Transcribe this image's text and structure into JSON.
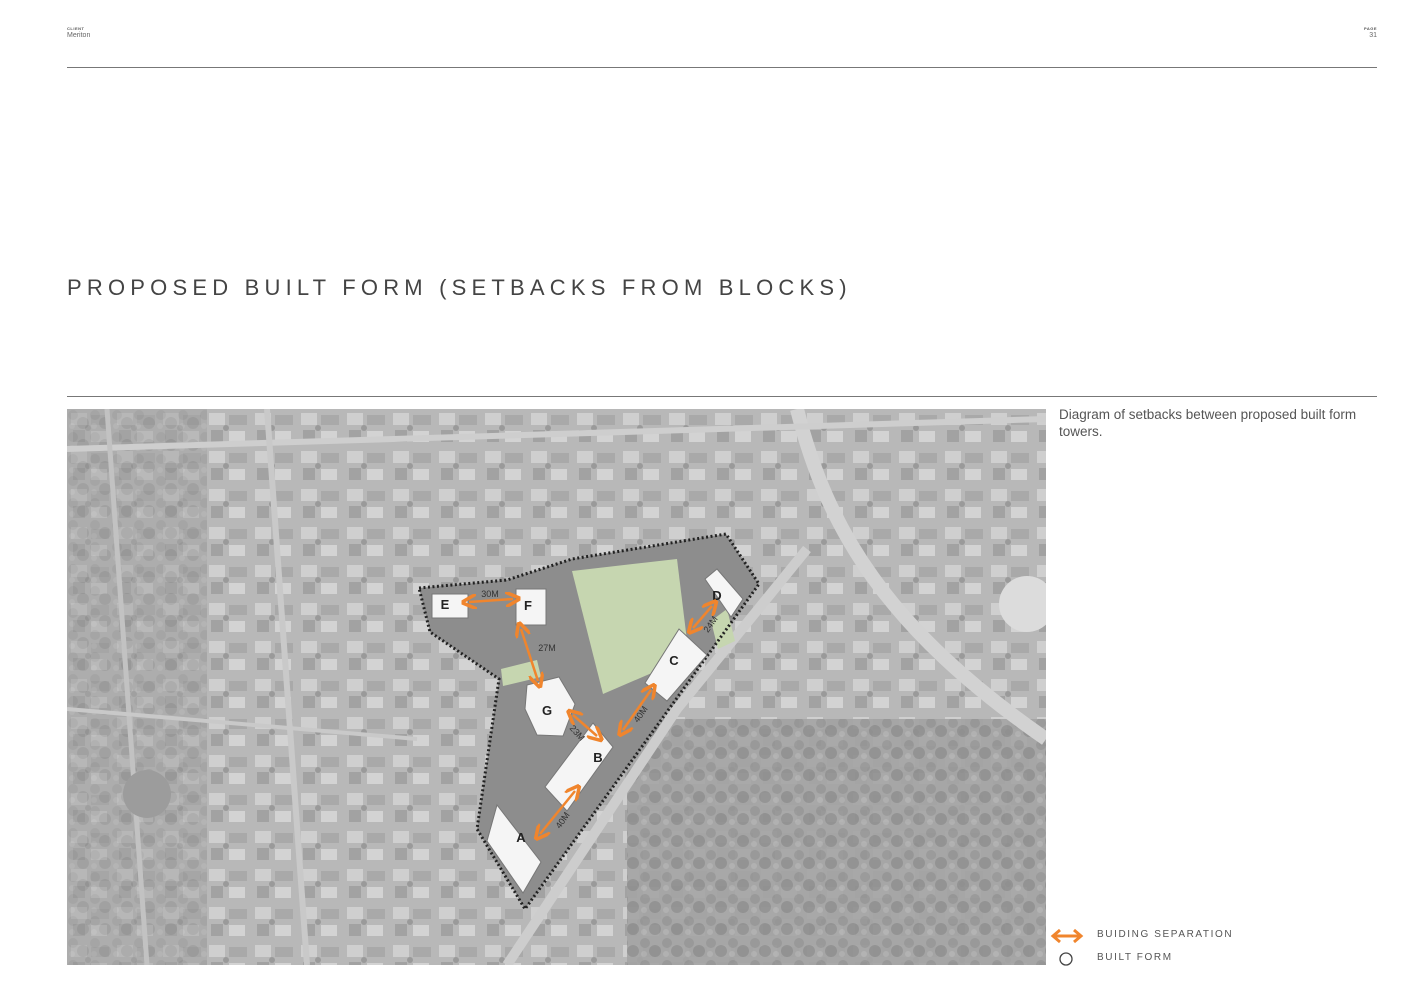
{
  "header": {
    "client_label": "CLIENT",
    "client_value": "Meriton",
    "page_label": "PAGE",
    "page_value": "31"
  },
  "title": "PROPOSED BUILT FORM (SETBACKS FROM BLOCKS)",
  "caption": "Diagram of setbacks between proposed built form towers.",
  "map": {
    "buildings": [
      "A",
      "B",
      "C",
      "D",
      "E",
      "F",
      "G"
    ],
    "separations": [
      "30M",
      "27M",
      "23M",
      "40M",
      "24M",
      "40M"
    ]
  },
  "legend": {
    "separation": "BUIDING SEPARATION",
    "built_form": "BUILT FORM"
  },
  "colors": {
    "accent": "#f0852d",
    "open_space": "#c6d6b0",
    "map_bg": "#b9b9b9"
  }
}
